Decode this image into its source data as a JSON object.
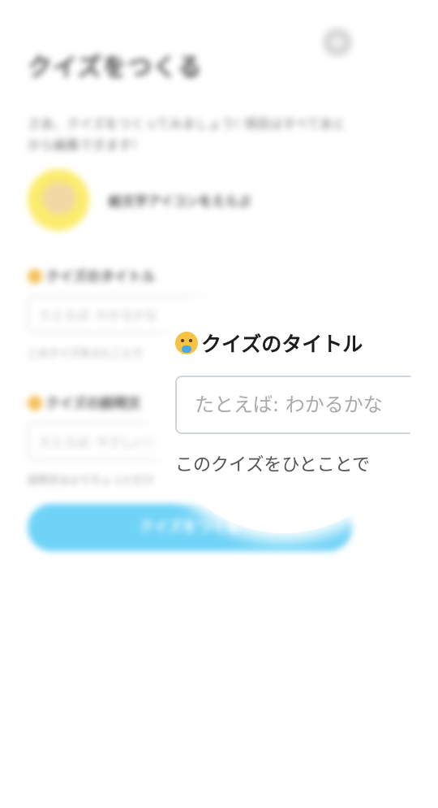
{
  "page": {
    "title": "クイズをつくる",
    "intro": "さあ、クイズをつくってみましょう! 項目はすべてあとから編集できます!",
    "avatar_link": "絵文字アイコンをえらぶ",
    "title_label": "クイズのタイトル",
    "title_placeholder": "たとえば: わかるかな",
    "title_hint": "このクイズをひとことで",
    "desc_label": "クイズの説明文",
    "desc_placeholder": "たとえば: やさしいクイズ",
    "desc_hint": "説明文はよりちょっとだけ",
    "submit_label": "クイズをつくる"
  },
  "magnifier": {
    "label": "クイズのタイトル",
    "placeholder": "たとえば: わかるかな",
    "hint": "このクイズをひとことで"
  },
  "icons": {
    "settings": "gear-icon",
    "label_icon": "baby-face-icon"
  },
  "colors": {
    "accent": "#6fd3f7",
    "avatar_bg": "#fbec6e"
  }
}
